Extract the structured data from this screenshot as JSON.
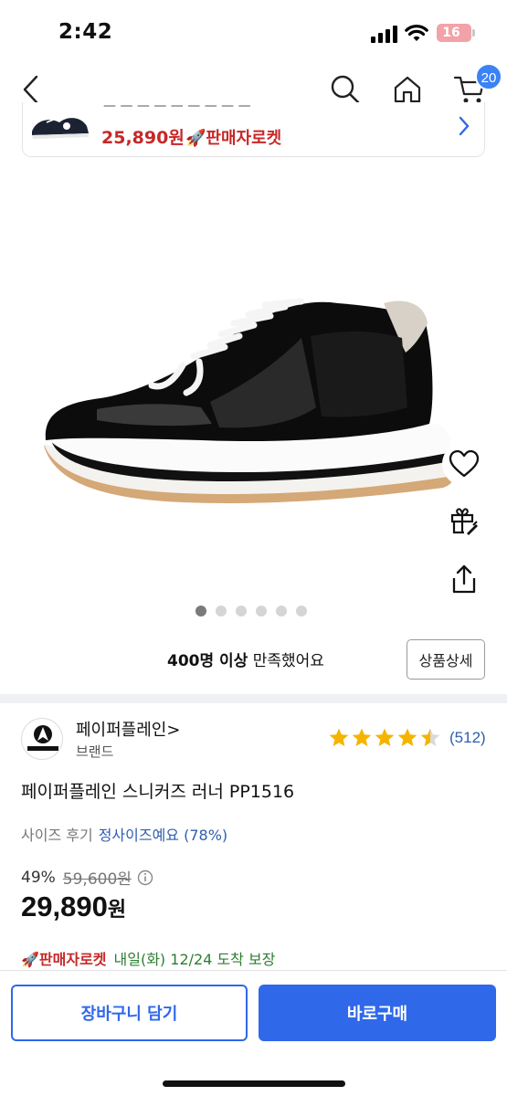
{
  "status_bar": {
    "time": "2:42",
    "battery": "16"
  },
  "nav": {
    "cart_count": "20"
  },
  "banner": {
    "price": "25,890원",
    "rocket_label": "🚀판매자로켓"
  },
  "gallery": {
    "image_count": 6,
    "active_index": 0
  },
  "satisfaction": {
    "count": "400명 이상",
    "suffix": " 만족했어요"
  },
  "detail_button": "상품상세",
  "brand": {
    "name": "페이퍼플레인>",
    "sub": "브랜드"
  },
  "rating": {
    "stars": 4.5,
    "review_count": "(512)"
  },
  "product": {
    "title": "페이퍼플레인 스니커즈 러너 PP1516",
    "size_review_label": "사이즈 후기",
    "size_review_value": "정사이즈예요 (78%)",
    "discount": "49%",
    "original_price": "59,600원",
    "price": "29,890",
    "price_unit": "원"
  },
  "delivery": {
    "rocket_label": "🚀판매자로켓",
    "date": "내일(화) 12/24 도착 보장"
  },
  "actions": {
    "cart_label": "장바구니 담기",
    "buy_label": "바로구매"
  },
  "colors": {
    "primary": "#2f68e9",
    "rocket_red": "#c62828",
    "star": "#f5b400"
  }
}
